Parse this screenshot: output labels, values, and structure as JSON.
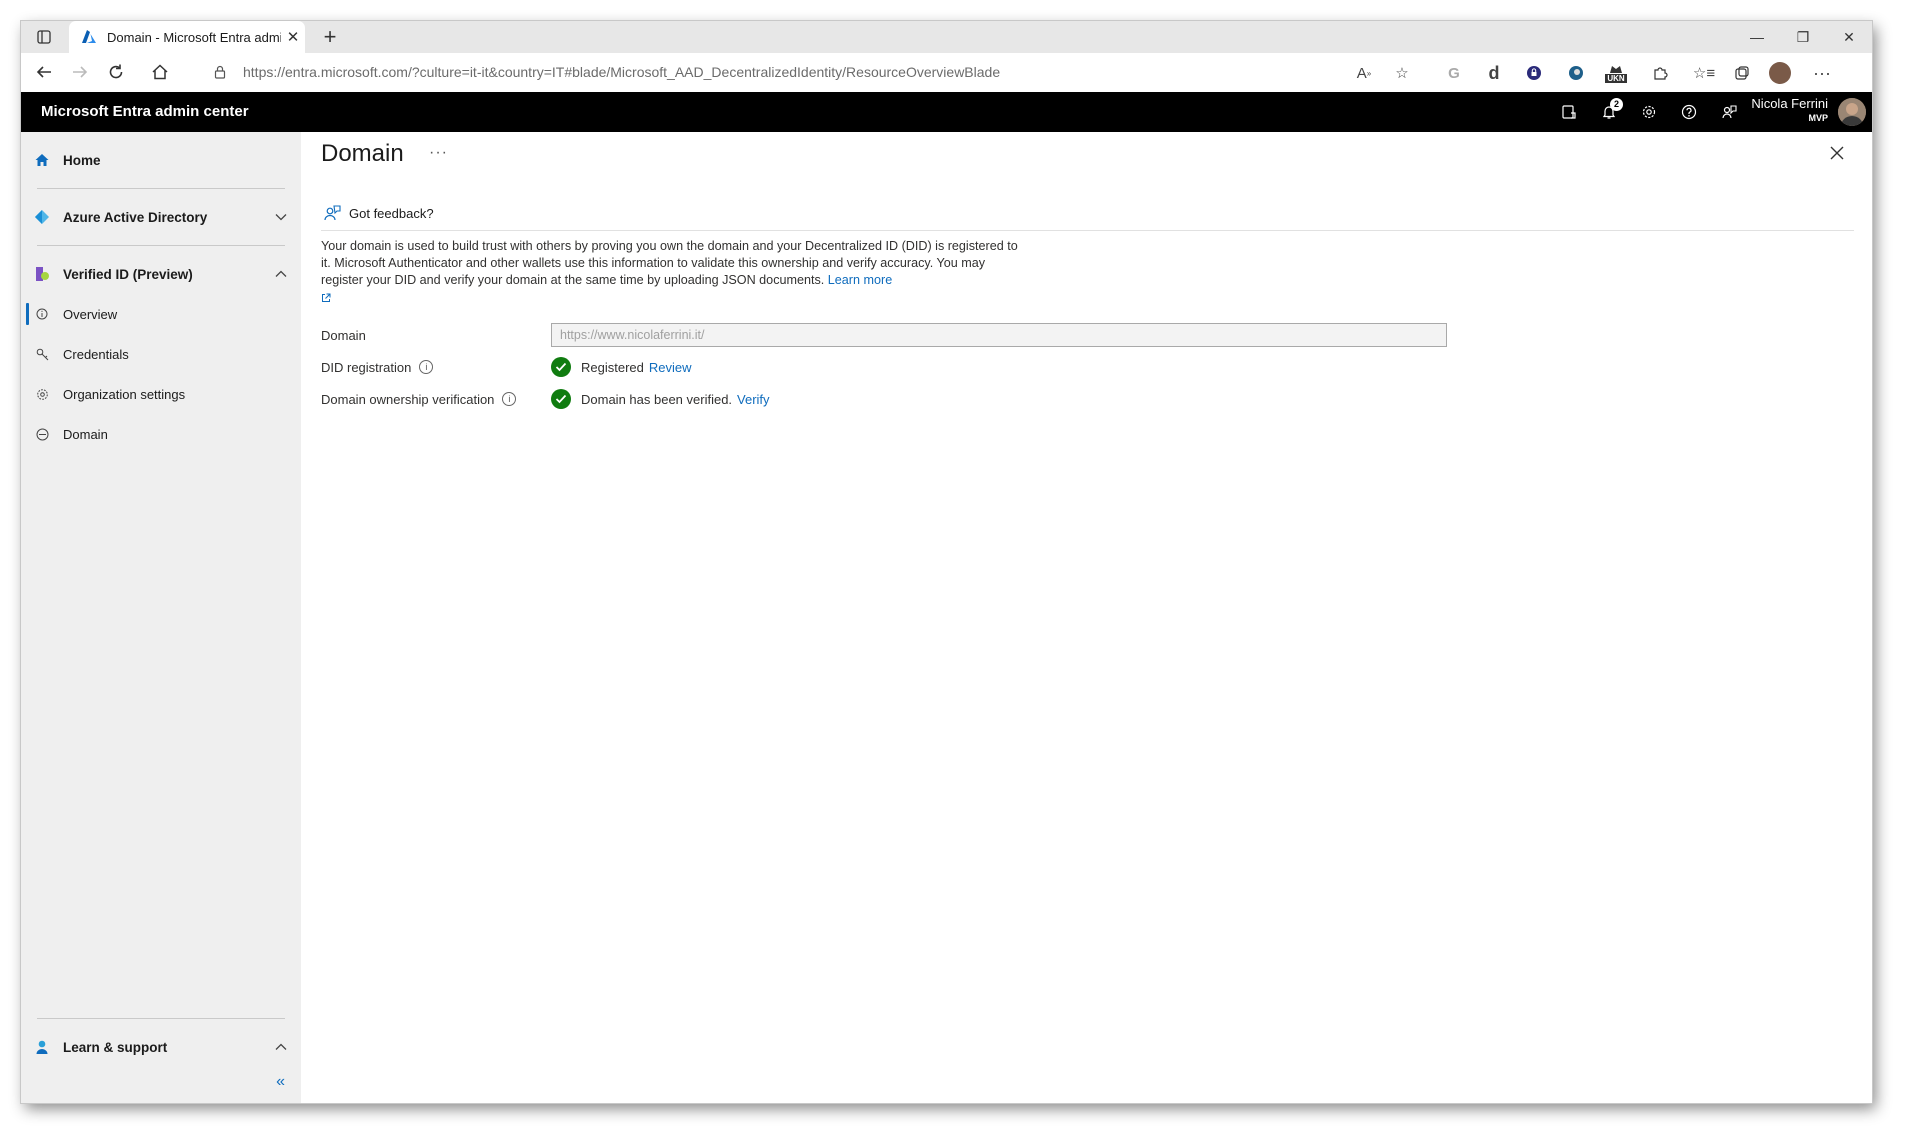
{
  "browser": {
    "tab_title": "Domain - Microsoft Entra admin",
    "url": "https://entra.microsoft.com/?culture=it-it&country=IT#blade/Microsoft_AAD_DecentralizedIdentity/ResourceOverviewBlade",
    "ext_ukn_label": "UKN"
  },
  "header": {
    "title": "Microsoft Entra admin center",
    "notifications_count": "2",
    "user_name": "Nicola Ferrini",
    "user_tag": "MVP"
  },
  "sidebar": {
    "home": "Home",
    "aad": "Azure Active Directory",
    "verified_id": "Verified ID (Preview)",
    "items": [
      {
        "label": "Overview"
      },
      {
        "label": "Credentials"
      },
      {
        "label": "Organization settings"
      },
      {
        "label": "Domain"
      }
    ],
    "learn_support": "Learn & support",
    "collapse_symbol": "«"
  },
  "main": {
    "title": "Domain",
    "more_symbol": "···",
    "feedback": "Got feedback?",
    "description": "Your domain is used to build trust with others by proving you own the domain and your Decentralized ID (DID) is registered to it. Microsoft Authenticator and other wallets use this information to validate this ownership and verify accuracy. You may register your DID and verify your domain at the same time by uploading JSON documents.",
    "learn_more": "Learn more",
    "form": {
      "domain_label": "Domain",
      "domain_value": "https://www.nicolaferrini.it/",
      "did_label": "DID registration",
      "did_status": "Registered",
      "did_link": "Review",
      "ownership_label": "Domain ownership verification",
      "ownership_status": "Domain has been verified.",
      "ownership_link": "Verify"
    }
  },
  "colors": {
    "accent": "#0f6cbd",
    "success": "#107c10",
    "header_bg": "#000000",
    "sidebar_bg": "#efefef"
  }
}
